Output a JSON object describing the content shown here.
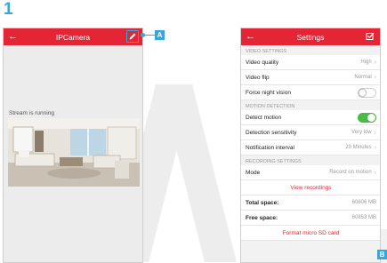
{
  "step_number": "1",
  "callouts": {
    "a": "A",
    "b": "B"
  },
  "colors": {
    "topbar": "#e42535",
    "accent": "#3aa6d6",
    "toggle_on": "#4cbb45"
  },
  "screen1": {
    "title": "IPCamera",
    "back_icon": "arrow-left-icon",
    "edit_icon": "pencil-icon",
    "stream_status": "Stream is running"
  },
  "screen2": {
    "title": "Settings",
    "back_icon": "arrow-left-icon",
    "save_icon": "check-square-icon",
    "sections": {
      "video": "VIDEO SETTINGS",
      "motion": "MOTION DETECTION",
      "recording": "RECORDING SETTINGS"
    },
    "video_quality": {
      "label": "Video quality",
      "value": "High"
    },
    "video_flip": {
      "label": "Video flip",
      "value": "Normal"
    },
    "force_night_vision": {
      "label": "Force night vision",
      "enabled": false
    },
    "detect_motion": {
      "label": "Detect motion",
      "enabled": true
    },
    "detection_sensitivity": {
      "label": "Detection sensitivity",
      "value": "Very low"
    },
    "notification_interval": {
      "label": "Notification interval",
      "value": "20 Minutes"
    },
    "mode": {
      "label": "Mode",
      "value": "Record on motion"
    },
    "view_recordings": "View recordings",
    "total_space": {
      "label": "Total space:",
      "value": "60606 MB"
    },
    "free_space": {
      "label": "Free space:",
      "value": "60853 MB"
    },
    "format_sd": "Format micro SD card"
  }
}
